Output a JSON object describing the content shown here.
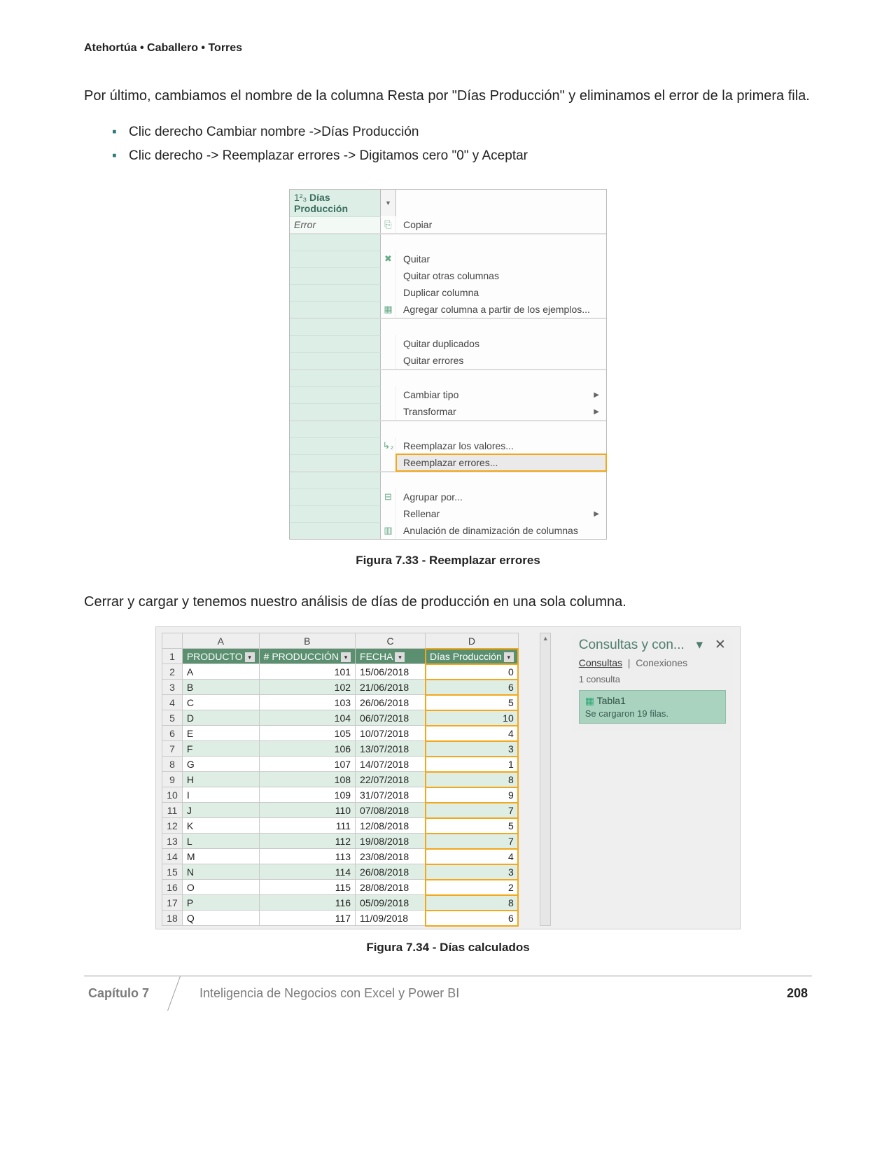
{
  "header": {
    "authors": "Atehortúa • Caballero • Torres"
  },
  "para1": "Por último, cambiamos el nombre de la columna Resta por \"Días Producción\" y eliminamos el error de la primera fila.",
  "bullets": [
    "Clic derecho Cambiar nombre ->Días Producción",
    "Clic derecho -> Reemplazar errores -> Digitamos cero \"0\" y Aceptar"
  ],
  "para2": "Cerrar y cargar y tenemos nuestro análisis de días de producción en una sola columna.",
  "fig33": {
    "col_prefix": "1²₃",
    "col_name": "Días Producción",
    "error_label": "Error",
    "menu": [
      {
        "icon": "⎘",
        "label": "Copiar"
      },
      {
        "sep": true
      },
      {
        "icon": "✖",
        "label": "Quitar"
      },
      {
        "icon": "",
        "label": "Quitar otras columnas"
      },
      {
        "icon": "",
        "label": "Duplicar columna"
      },
      {
        "icon": "▦",
        "label": "Agregar columna a partir de los ejemplos..."
      },
      {
        "sep": true
      },
      {
        "icon": "",
        "label": "Quitar duplicados"
      },
      {
        "icon": "",
        "label": "Quitar errores"
      },
      {
        "sep": true
      },
      {
        "icon": "",
        "label": "Cambiar tipo",
        "sub": true
      },
      {
        "icon": "",
        "label": "Transformar",
        "sub": true
      },
      {
        "sep": true
      },
      {
        "icon": "↳₂",
        "label": "Reemplazar los valores..."
      },
      {
        "icon": "",
        "label": "Reemplazar errores...",
        "highlight": true
      },
      {
        "sep": true
      },
      {
        "icon": "⊟",
        "label": "Agrupar por..."
      },
      {
        "icon": "",
        "label": "Rellenar",
        "sub": true
      },
      {
        "icon": "▥",
        "label": "Anulación de dinamización de columnas"
      }
    ],
    "caption": "Figura 7.33 - Reemplazar errores"
  },
  "fig34": {
    "cols": [
      "A",
      "B",
      "C",
      "D"
    ],
    "headers": [
      "PRODUCTO",
      "# PRODUCCIÓN",
      "FECHA",
      "Días Producción"
    ],
    "rows": [
      [
        "A",
        101,
        "15/06/2018",
        0
      ],
      [
        "B",
        102,
        "21/06/2018",
        6
      ],
      [
        "C",
        103,
        "26/06/2018",
        5
      ],
      [
        "D",
        104,
        "06/07/2018",
        10
      ],
      [
        "E",
        105,
        "10/07/2018",
        4
      ],
      [
        "F",
        106,
        "13/07/2018",
        3
      ],
      [
        "G",
        107,
        "14/07/2018",
        1
      ],
      [
        "H",
        108,
        "22/07/2018",
        8
      ],
      [
        "I",
        109,
        "31/07/2018",
        9
      ],
      [
        "J",
        110,
        "07/08/2018",
        7
      ],
      [
        "K",
        111,
        "12/08/2018",
        5
      ],
      [
        "L",
        112,
        "19/08/2018",
        7
      ],
      [
        "M",
        113,
        "23/08/2018",
        4
      ],
      [
        "N",
        114,
        "26/08/2018",
        3
      ],
      [
        "O",
        115,
        "28/08/2018",
        2
      ],
      [
        "P",
        116,
        "05/09/2018",
        8
      ],
      [
        "Q",
        117,
        "11/09/2018",
        6
      ]
    ],
    "pane": {
      "title": "Consultas y con...",
      "tab1": "Consultas",
      "tab2": "Conexiones",
      "count": "1 consulta",
      "card_title": "Tabla1",
      "card_sub": "Se cargaron 19 filas."
    },
    "caption": "Figura 7.34 - Días calculados"
  },
  "footer": {
    "chapter": "Capítulo 7",
    "title": "Inteligencia de Negocios con Excel y Power BI",
    "page": "208"
  }
}
